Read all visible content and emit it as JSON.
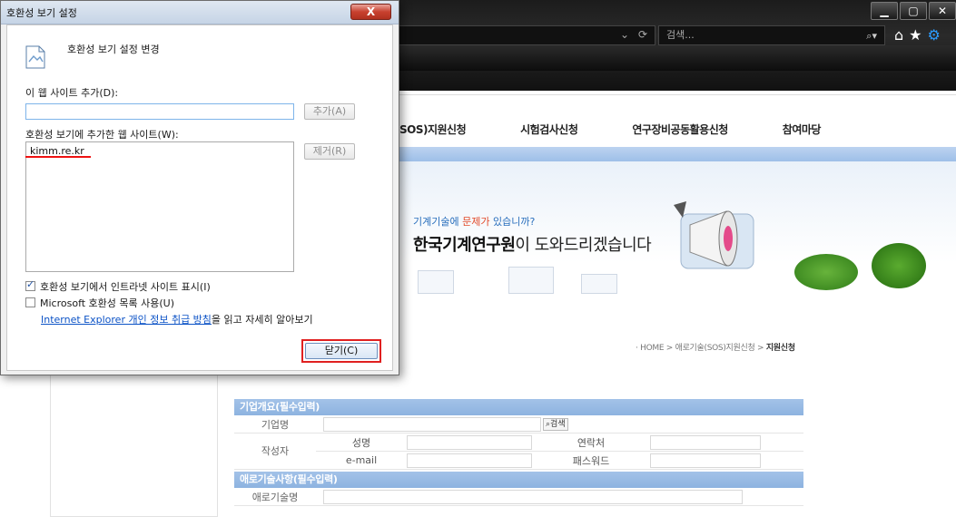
{
  "browser": {
    "search_placeholder": "검색...",
    "refresh_glyph": "⟳",
    "dropdown_glyph": "⌄",
    "search_glyph": "⌕",
    "search_dropdown": "▾",
    "minimize": "▁",
    "maximize": "▢",
    "close": "✕",
    "home_icon": "⌂",
    "favorites_icon": "★",
    "tools_icon": "⚙"
  },
  "site": {
    "gnb": [
      "SOS)지원신청",
      "시험검사신청",
      "연구장비공동활용신청",
      "참여마당"
    ],
    "visual_sub_before": "기계기술에 ",
    "visual_sub_red": "문제가",
    "visual_sub_after": " 있습니까?",
    "visual_main_bold": "한국기계연구원",
    "visual_main_rest": "이 도와드리겠습니다",
    "breadcrumb_path": "· HOME > 애로기술(SOS)지원신청 > ",
    "breadcrumb_current": "지원신청",
    "form": {
      "section1": "기업개요(필수입력)",
      "company_label": "기업명",
      "search_button": "검색",
      "writer_label": "작성자",
      "name_label": "성명",
      "contact_label": "연락처",
      "email_label": "e-mail",
      "password_label": "패스워드",
      "section2": "애로기술사항(필수입력)",
      "tech_label": "애로기술명"
    }
  },
  "dialog": {
    "title": "호환성 보기 설정",
    "close_glyph": "X",
    "heading": "호환성 보기 설정 변경",
    "add_label": "이 웹 사이트 추가(D):",
    "add_input_value": "",
    "add_button": "추가(A)",
    "list_label": "호환성 보기에 추가한 웹 사이트(W):",
    "remove_button": "제거(R)",
    "sites": [
      "kimm.re.kr"
    ],
    "check1_label": "호환성 보기에서 인트라넷 사이트 표시(I)",
    "check1_checked": true,
    "check2_label": "Microsoft 호환성 목록 사용(U)",
    "check2_checked": false,
    "privacy_link": "Internet Explorer 개인 정보 취급 방침",
    "privacy_rest": "을 읽고 자세히 알아보기",
    "close_button": "닫기(C)"
  }
}
